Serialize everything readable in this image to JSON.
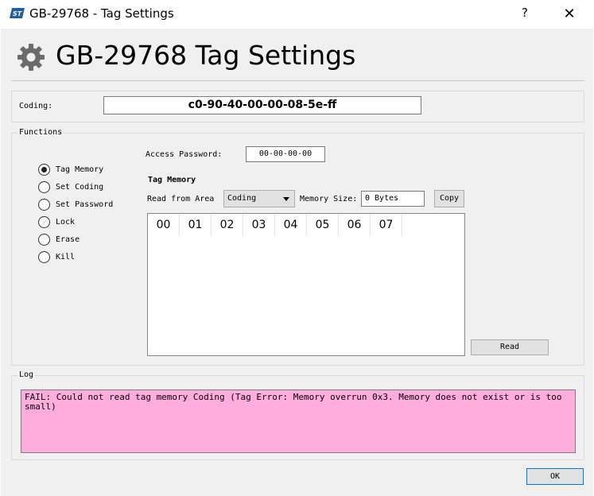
{
  "window": {
    "title": "GB-29768 - Tag Settings",
    "help_label": "?",
    "close_label": "✕",
    "app_icon": "st-logo-icon",
    "accent_color": "#0078d7"
  },
  "header": {
    "title": "GB-29768 Tag Settings",
    "icon": "gear-icon"
  },
  "coding": {
    "label": "Coding:",
    "value": "c0-90-40-00-00-08-5e-ff"
  },
  "functions": {
    "group_title": "Functions",
    "options": [
      {
        "label": "Tag Memory",
        "selected": true
      },
      {
        "label": "Set Coding",
        "selected": false
      },
      {
        "label": "Set Password",
        "selected": false
      },
      {
        "label": "Lock",
        "selected": false
      },
      {
        "label": "Erase",
        "selected": false
      },
      {
        "label": "Kill",
        "selected": false
      }
    ],
    "access_password_label": "Access Password:",
    "access_password_value": "00-00-00-00",
    "tag_memory_heading": "Tag Memory",
    "read_from_area_label": "Read from Area",
    "area_selected": "Coding",
    "memory_size_label": "Memory Size:",
    "memory_size_value": "0 Bytes",
    "copy_label": "Copy",
    "hex_columns": [
      "00",
      "01",
      "02",
      "03",
      "04",
      "05",
      "06",
      "07"
    ],
    "read_label": "Read"
  },
  "log": {
    "group_title": "Log",
    "message": "FAIL: Could not read tag memory Coding (Tag Error: Memory overrun 0x3. Memory does not exist or is too small)",
    "background_color": "#ffaddc"
  },
  "footer": {
    "ok_label": "OK"
  }
}
